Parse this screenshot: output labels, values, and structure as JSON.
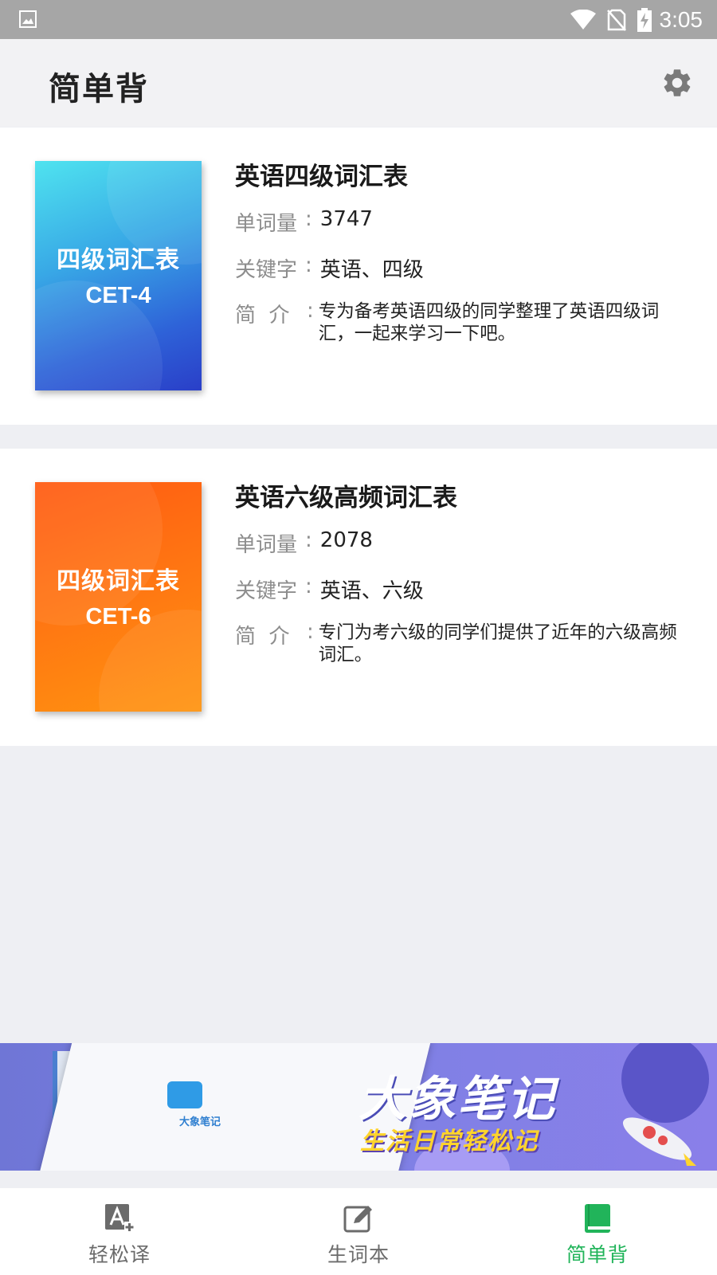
{
  "statusbar": {
    "time": "3:05"
  },
  "header": {
    "title": "简单背"
  },
  "books": [
    {
      "cover_line1": "四级词汇表",
      "cover_line2": "CET-4",
      "title": "英语四级词汇表",
      "count_label": "单词量",
      "count": "3747",
      "keyword_label": "关键字",
      "keywords": "英语、四级",
      "desc_label": "简  介",
      "description": "专为备考英语四级的同学整理了英语四级词汇，一起来学习一下吧。"
    },
    {
      "cover_line1": "四级词汇表",
      "cover_line2": "CET-6",
      "title": "英语六级高频词汇表",
      "count_label": "单词量",
      "count": "2078",
      "keyword_label": "关键字",
      "keywords": "英语、六级",
      "desc_label": "简  介",
      "description": "专门为考六级的同学们提供了近年的六级高频词汇。"
    }
  ],
  "banner": {
    "title": "大象笔记",
    "subtitle": "生活日常轻松记",
    "logo_text": "大象笔记"
  },
  "nav": {
    "tabs": [
      {
        "label": "轻松译",
        "icon": "translate-icon",
        "active": false
      },
      {
        "label": "生词本",
        "icon": "edit-note-icon",
        "active": false
      },
      {
        "label": "简单背",
        "icon": "book-icon",
        "active": true
      }
    ]
  },
  "colors": {
    "accent_green": "#21b45a",
    "status_bar": "#a6a6a6",
    "cover_blue": "#2e62d8",
    "cover_orange": "#ff7412"
  }
}
